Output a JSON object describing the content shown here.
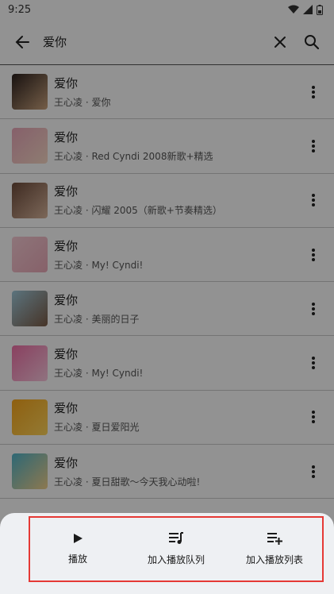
{
  "status_bar": {
    "time": "9:25"
  },
  "app_bar": {
    "query": "爱你"
  },
  "results": [
    {
      "title": "爱你",
      "subtitle": "王心凌 · 爱你",
      "cover_colors": [
        "#2a1f1c",
        "#c9a27d"
      ]
    },
    {
      "title": "爱你",
      "subtitle": "王心凌 · Red Cyndi 2008新歌+精选",
      "cover_colors": [
        "#e7a6b8",
        "#f5d7c4"
      ]
    },
    {
      "title": "爱你",
      "subtitle": "王心凌 · 闪耀 2005（新歌+节奏精选）",
      "cover_colors": [
        "#6c4a3a",
        "#d6b39a"
      ]
    },
    {
      "title": "爱你",
      "subtitle": "王心凌 · My! Cyndi!",
      "cover_colors": [
        "#f4c9d2",
        "#e8a8b6"
      ]
    },
    {
      "title": "爱你",
      "subtitle": "王心凌 · 美丽的日子",
      "cover_colors": [
        "#9ec7d8",
        "#7a5a45"
      ]
    },
    {
      "title": "爱你",
      "subtitle": "王心凌 · My! Cyndi!",
      "cover_colors": [
        "#ee6fa6",
        "#f7c6dc"
      ]
    },
    {
      "title": "爱你",
      "subtitle": "王心凌 · 夏日爱阳光",
      "cover_colors": [
        "#f6a51c",
        "#fdd35a"
      ]
    },
    {
      "title": "爱你",
      "subtitle": "王心凌 · 夏日甜歌～今天我心动啦!",
      "cover_colors": [
        "#4fb3c9",
        "#f2d08a"
      ]
    }
  ],
  "sheet": {
    "actions": [
      {
        "label": "播放",
        "icon": "play-icon"
      },
      {
        "label": "加入播放队列",
        "icon": "queue-music-icon"
      },
      {
        "label": "加入播放列表",
        "icon": "playlist-add-icon"
      }
    ],
    "highlight_color": "#e53935"
  }
}
